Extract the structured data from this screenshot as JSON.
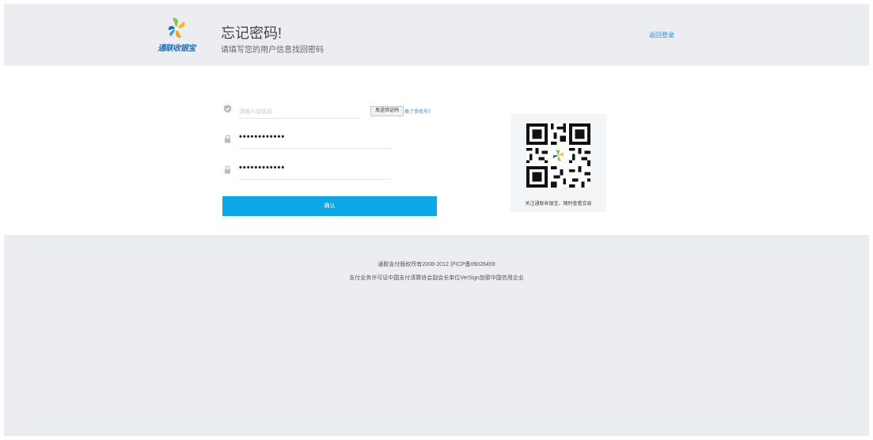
{
  "header": {
    "logo_text": "通联收银宝",
    "title": "忘记密码!",
    "subtitle": "请填写您的用户信息找回密码",
    "back_link": "返回登录"
  },
  "form": {
    "code_placeholder": "请输入验证码",
    "send_code_label": "发送验证码",
    "phone_link_label": "换了手机号?",
    "password_value": "••••••••••••",
    "confirm_password_value": "••••••••••••",
    "confirm_label": "确认"
  },
  "qr": {
    "caption": "关注通联收银宝，随时查看交易"
  },
  "footer": {
    "copyright": "通联支付版权所有2008-2012 沪ICP备09026459",
    "certs": "支付业务许可证中国支付清算协会副会长单位VerSign加密中国信用企业"
  },
  "colors": {
    "accent": "#0ba7e7",
    "link": "#2d8ae0",
    "background": "#ebedf0"
  }
}
